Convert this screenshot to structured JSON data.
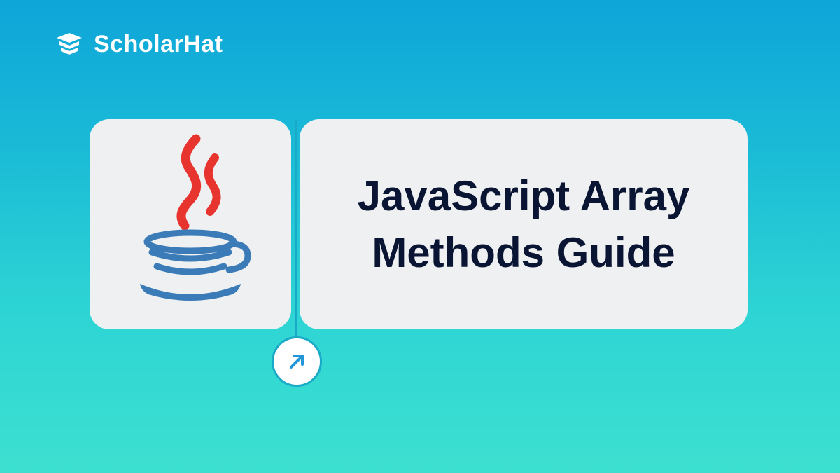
{
  "brand": {
    "name": "ScholarHat"
  },
  "card": {
    "title_line1": "JavaScript Array",
    "title_line2": "Methods Guide"
  },
  "colors": {
    "bg_gradient_start": "#0ea5d9",
    "bg_gradient_end": "#3de0d0",
    "card_bg": "#eef0f1",
    "text_dark": "#0a1433",
    "accent_teal": "#1aa9c7",
    "java_red": "#e8342f",
    "java_blue": "#3b7bb8"
  }
}
